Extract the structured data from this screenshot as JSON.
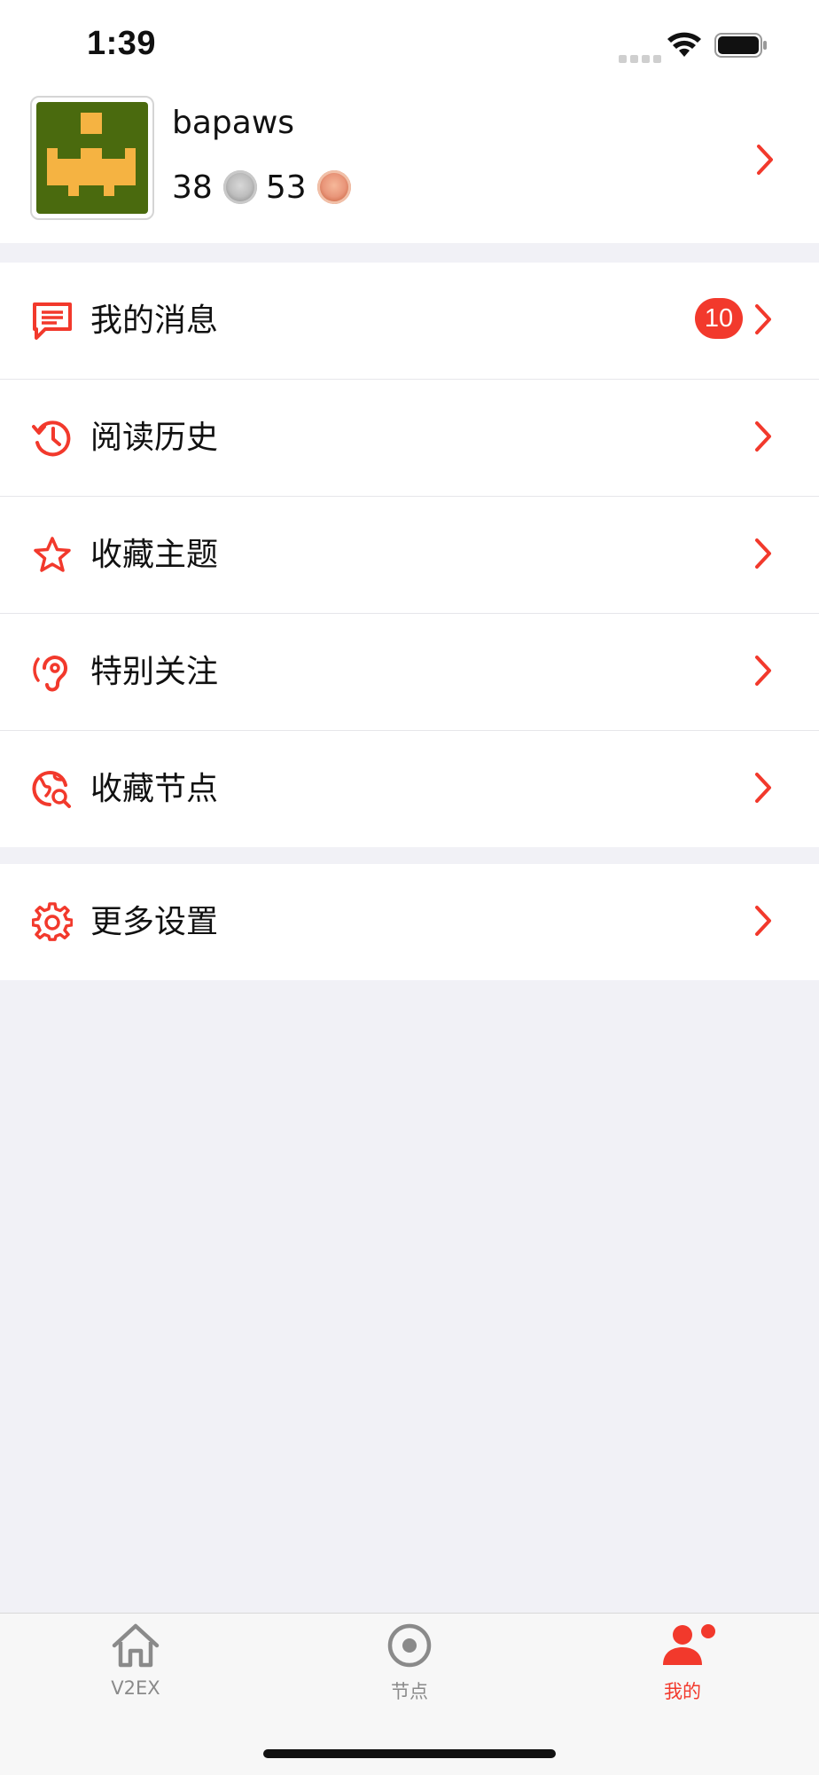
{
  "status_bar": {
    "time": "1:39"
  },
  "profile": {
    "username": "bapaws",
    "silver_count": "38",
    "bronze_count": "53"
  },
  "menu": {
    "items": [
      {
        "label": "我的消息",
        "icon": "message-icon",
        "badge": "10"
      },
      {
        "label": "阅读历史",
        "icon": "history-icon"
      },
      {
        "label": "收藏主题",
        "icon": "star-icon"
      },
      {
        "label": "特别关注",
        "icon": "ear-icon"
      },
      {
        "label": "收藏节点",
        "icon": "globe-search-icon"
      }
    ],
    "settings": {
      "label": "更多设置",
      "icon": "gear-icon"
    }
  },
  "tabbar": {
    "tabs": [
      {
        "label": "V2EX",
        "icon": "home-icon"
      },
      {
        "label": "节点",
        "icon": "node-icon"
      },
      {
        "label": "我的",
        "icon": "person-icon"
      }
    ]
  },
  "colors": {
    "accent": "#f2392c",
    "background": "#f1f1f6",
    "avatar_bg": "#4a6a0e",
    "avatar_fg": "#f5b342"
  }
}
